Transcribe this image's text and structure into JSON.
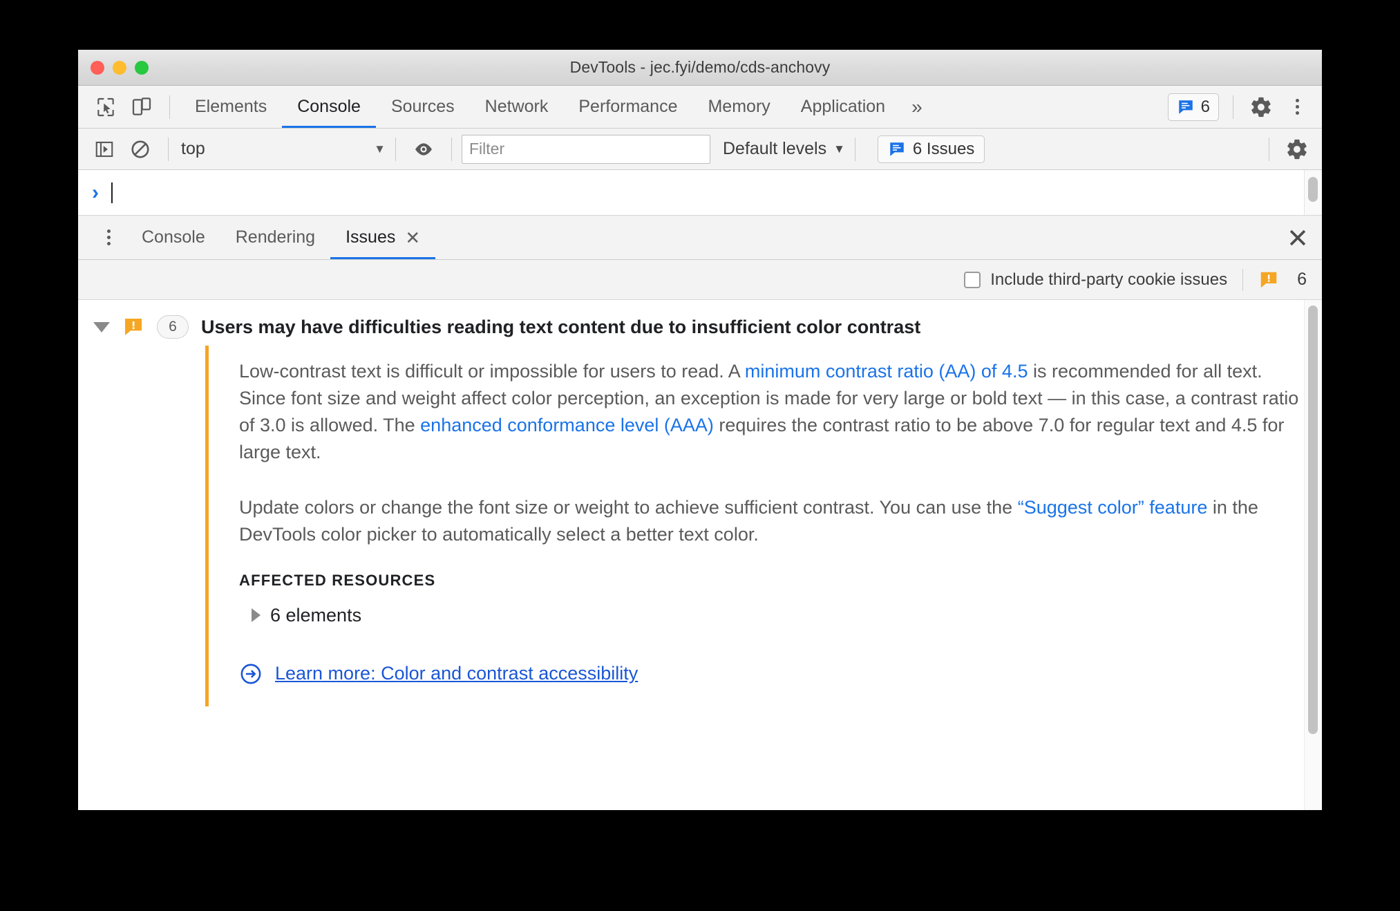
{
  "window": {
    "title": "DevTools - jec.fyi/demo/cds-anchovy",
    "traffic_lights": [
      "close",
      "minimize",
      "zoom"
    ]
  },
  "main_toolbar": {
    "inspect_icon": "inspect-cursor-icon",
    "device_icon": "device-toolbar-icon",
    "tabs": [
      {
        "label": "Elements",
        "active": false
      },
      {
        "label": "Console",
        "active": true
      },
      {
        "label": "Sources",
        "active": false
      },
      {
        "label": "Network",
        "active": false
      },
      {
        "label": "Performance",
        "active": false
      },
      {
        "label": "Memory",
        "active": false
      },
      {
        "label": "Application",
        "active": false
      }
    ],
    "overflow_label": "»",
    "issues_count": "6",
    "settings_icon": "gear-icon",
    "more_icon": "more-vertical-icon"
  },
  "filter_toolbar": {
    "sidebar_icon": "console-sidebar-icon",
    "clear_icon": "clear-console-icon",
    "context": "top",
    "context_caret": "▼",
    "eye_icon": "live-expression-icon",
    "filter_placeholder": "Filter",
    "filter_value": "",
    "levels_label": "Default levels",
    "levels_caret": "▼",
    "issues_label": "6 Issues",
    "settings_icon": "console-settings-gear-icon"
  },
  "console_prompt": {
    "arrow": "›",
    "value": ""
  },
  "drawer": {
    "menu_icon": "more-vertical-icon",
    "tabs": [
      {
        "label": "Console",
        "active": false,
        "closable": false
      },
      {
        "label": "Rendering",
        "active": false,
        "closable": false
      },
      {
        "label": "Issues",
        "active": true,
        "closable": true
      }
    ],
    "tab_close_glyph": "✕",
    "close_drawer_glyph": "✕"
  },
  "issues_options": {
    "checkbox_label": "Include third-party cookie issues",
    "checkbox_checked": false,
    "warning_icon": "warning-issue-icon",
    "warning_count": "6"
  },
  "issue": {
    "expanded": true,
    "icon": "warning-issue-icon",
    "count": "6",
    "title": "Users may have difficulties reading text content due to insufficient color contrast",
    "paragraph1": {
      "part1": "Low-contrast text is difficult or impossible for users to read. A ",
      "link1": "minimum contrast ratio (AA) of 4.5",
      "part2": " is recommended for all text. Since font size and weight affect color perception, an exception is made for very large or bold text — in this case, a contrast ratio of 3.0 is allowed. The ",
      "link2": "enhanced conformance level (AAA)",
      "part3": " requires the contrast ratio to be above 7.0 for regular text and 4.5 for large text."
    },
    "paragraph2": {
      "part1": "Update colors or change the font size or weight to achieve sufficient contrast. You can use the ",
      "link1": "“Suggest color” feature",
      "part2": " in the DevTools color picker to automatically select a better text color."
    },
    "affected_resources_heading": "AFFECTED RESOURCES",
    "affected_resource_label": "6 elements",
    "learn_more_icon": "arrow-circle-right-icon",
    "learn_more_label": "Learn more: Color and contrast accessibility"
  },
  "colors": {
    "accent_blue": "#1a73e8",
    "link_blue": "#1a56d6",
    "warning_orange": "#f5a623",
    "toolbar_bg": "#f3f3f3",
    "text": "#5a5a5a"
  }
}
